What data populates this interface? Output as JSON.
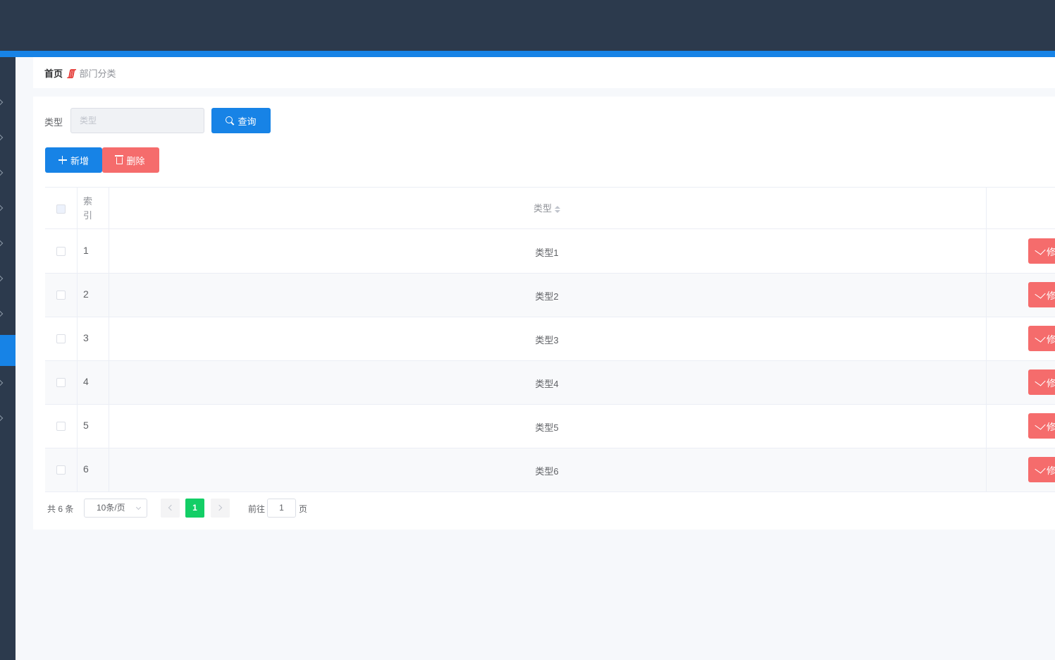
{
  "colors": {
    "topbar": "#2c3a4d",
    "accent": "#1783e6",
    "danger": "#f56c6c",
    "success": "#13ce66"
  },
  "breadcrumb": {
    "home": "首页",
    "separator": "ʃʃʃ",
    "current": "部门分类"
  },
  "filter": {
    "label": "类型",
    "placeholder": "类型",
    "value": "",
    "query_label": "查询"
  },
  "toolbar": {
    "add_label": "新增",
    "delete_label": "删除"
  },
  "table": {
    "headers": {
      "index": "索引",
      "type": "类型"
    },
    "rows": [
      {
        "index": "1",
        "type": "类型1",
        "action": "修改"
      },
      {
        "index": "2",
        "type": "类型2",
        "action": "修改"
      },
      {
        "index": "3",
        "type": "类型3",
        "action": "修改"
      },
      {
        "index": "4",
        "type": "类型4",
        "action": "修改"
      },
      {
        "index": "5",
        "type": "类型5",
        "action": "修改"
      },
      {
        "index": "6",
        "type": "类型6",
        "action": "修改"
      }
    ]
  },
  "pagination": {
    "total": "共 6 条",
    "page_size": "10条/页",
    "current_page": "1",
    "goto_label": "前往",
    "goto_value": "1",
    "goto_unit": "页"
  }
}
